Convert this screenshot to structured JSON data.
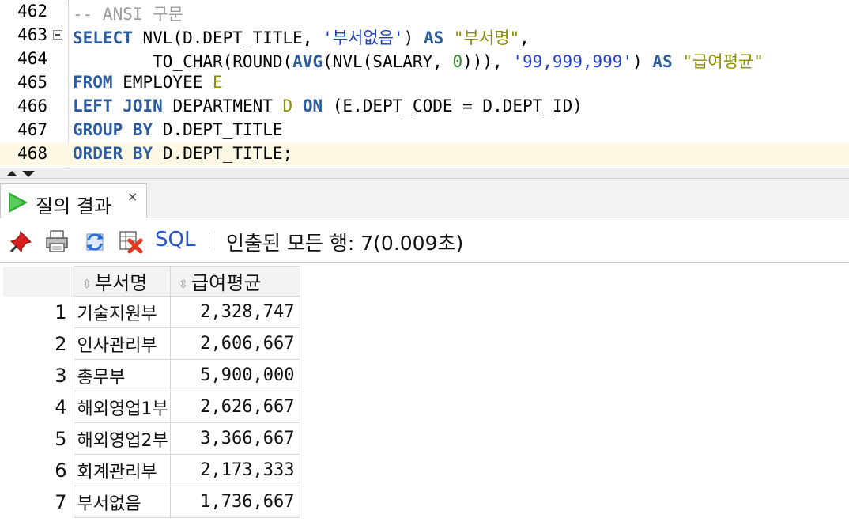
{
  "editor": {
    "lines": [
      {
        "num": "462",
        "text": "-- ANSI 구문"
      },
      {
        "num": "463",
        "text": "SELECT NVL(D.DEPT_TITLE, '부서없음') AS \"부서명\","
      },
      {
        "num": "464",
        "text": "        TO_CHAR(ROUND(AVG(NVL(SALARY, 0))), '99,999,999') AS \"급여평균\""
      },
      {
        "num": "465",
        "text": "FROM EMPLOYEE E"
      },
      {
        "num": "466",
        "text": "LEFT JOIN DEPARTMENT D ON (E.DEPT_CODE = D.DEPT_ID)"
      },
      {
        "num": "467",
        "text": "GROUP BY D.DEPT_TITLE"
      },
      {
        "num": "468",
        "text": "ORDER BY D.DEPT_TITLE;"
      }
    ]
  },
  "result_tab": {
    "label": "질의 결과",
    "close": "×"
  },
  "toolbar": {
    "icons": [
      "pin-icon",
      "print-icon",
      "refresh-icon",
      "delete-icon"
    ],
    "sql_label": "SQL",
    "divider": "|",
    "status": "인출된 모든 행: 7(0.009초)"
  },
  "grid": {
    "columns": [
      "부서명",
      "급여평균"
    ],
    "rows": [
      {
        "n": "1",
        "dept": "기술지원부",
        "avg": "2,328,747"
      },
      {
        "n": "2",
        "dept": "인사관리부",
        "avg": "2,606,667"
      },
      {
        "n": "3",
        "dept": "총무부",
        "avg": "5,900,000"
      },
      {
        "n": "4",
        "dept": "해외영업1부",
        "avg": "2,626,667"
      },
      {
        "n": "5",
        "dept": "해외영업2부",
        "avg": "3,366,667"
      },
      {
        "n": "6",
        "dept": "회계관리부",
        "avg": "2,173,333"
      },
      {
        "n": "7",
        "dept": "부서없음",
        "avg": "1,736,667"
      }
    ]
  },
  "colors": {
    "keyword": "#2c5c9e",
    "string": "#1f3fd1",
    "identifier": "#8c8c00",
    "number": "#2a8f2a",
    "comment": "#9a9a9a",
    "current_line": "#fdf8e4"
  }
}
